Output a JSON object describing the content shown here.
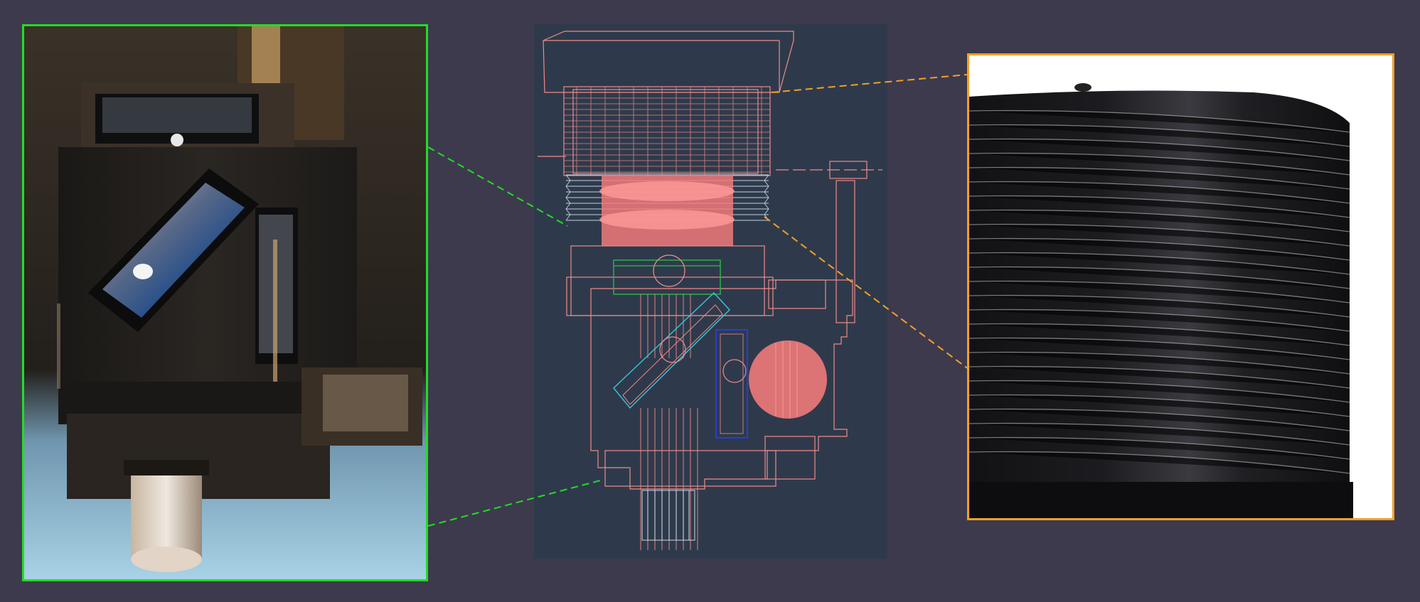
{
  "colors": {
    "background": "#3d3a4d",
    "left_border": "#22dd22",
    "right_border": "#f2a024",
    "cad_background": "#2e3a4b",
    "wireframe_main": "#f08a8a",
    "wireframe_fill": "#f07a7a",
    "wire_green": "#2ea84a",
    "wire_blue": "#2b3bd6",
    "wire_cyan": "#3ac6d8",
    "wire_white": "#d6eef6",
    "print_black": "#131316"
  },
  "panels": {
    "left": {
      "icon": "printed-part-closeup-photo"
    },
    "center": {
      "icon": "cad-wireframe-model"
    },
    "right": {
      "icon": "thread-macro-photo"
    }
  }
}
